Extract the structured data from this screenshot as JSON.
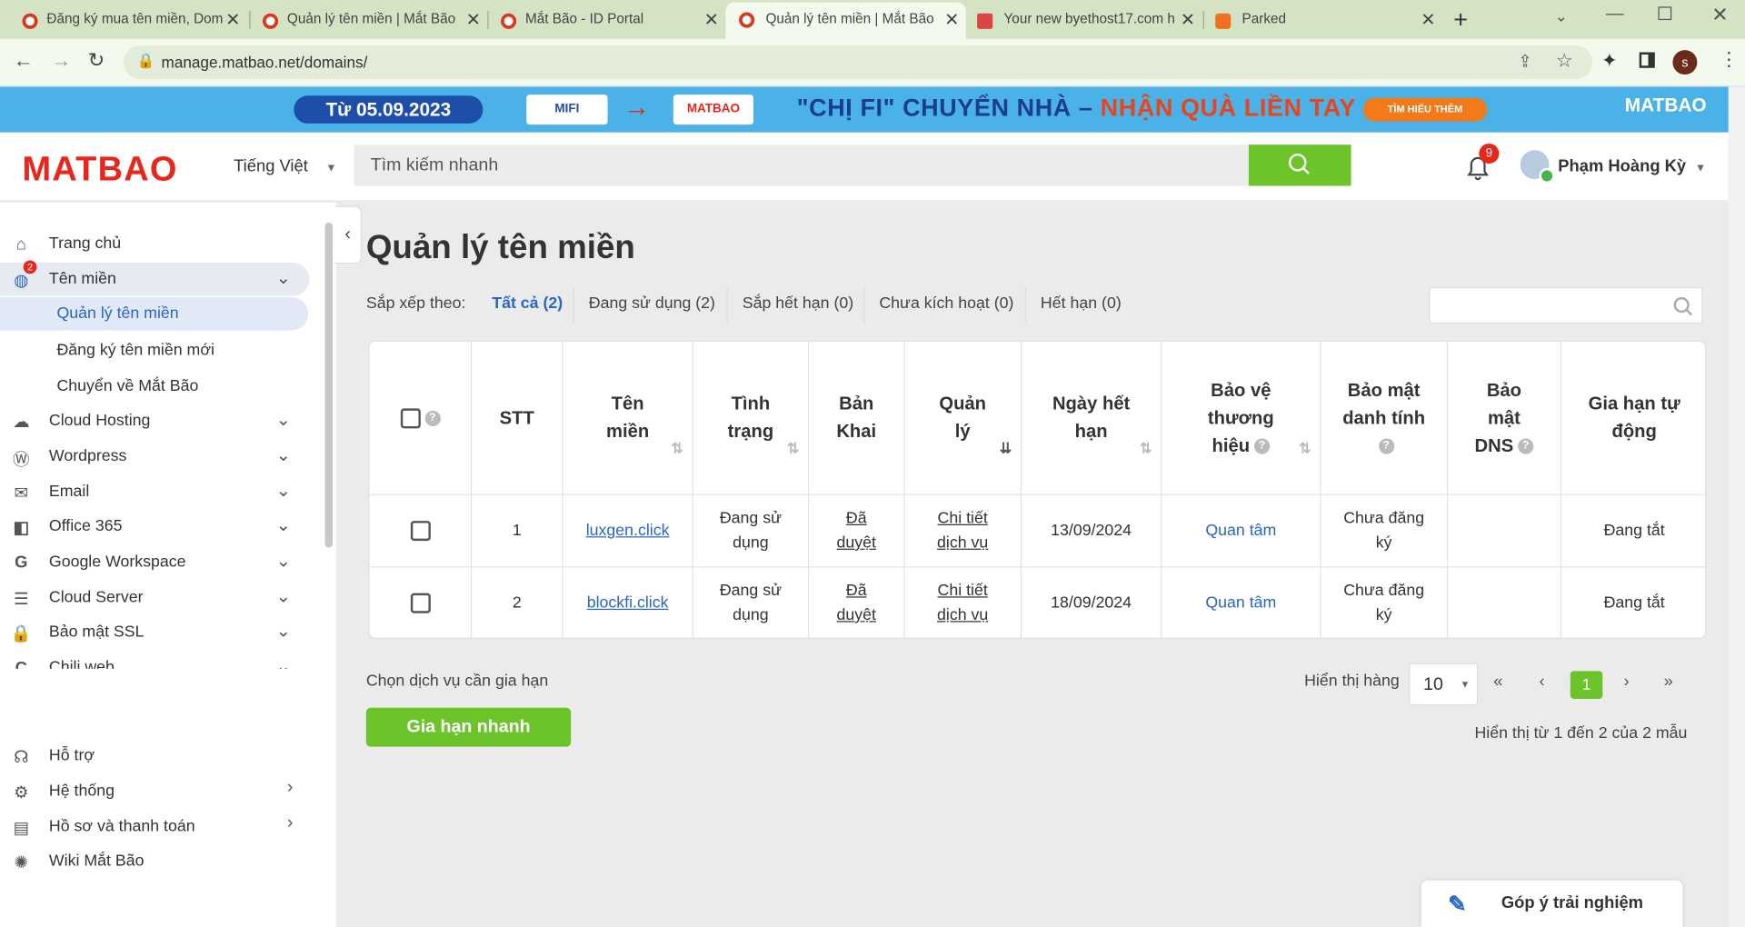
{
  "browser": {
    "tabs": [
      {
        "title": "Đăng ký mua tên miền, Dom"
      },
      {
        "title": "Quản lý tên miền | Mắt Bão"
      },
      {
        "title": "Mắt Bão - ID Portal"
      },
      {
        "title": "Quản lý tên miền | Mắt Bão"
      },
      {
        "title": "Your new byethost17.com h"
      },
      {
        "title": "Parked"
      }
    ],
    "url": "manage.matbao.net/domains/",
    "profile_initial": "s"
  },
  "banner": {
    "date": "Từ 05.09.2023",
    "mifi": "MIFI",
    "matbao_invoice": "MATBAO",
    "slogan_part1": "\"CHỊ FI\" CHUYỂN NHÀ – ",
    "slogan_part2": "NHẬN QUÀ LIỀN TAY",
    "more": "TÌM HIỂU THÊM",
    "logo": "MATBAO"
  },
  "header": {
    "logo": "MATBAO",
    "language": "Tiếng Việt",
    "search_placeholder": "Tìm kiếm nhanh",
    "notification_count": "9",
    "user_name": "Phạm Hoàng Kỳ"
  },
  "sidebar": {
    "items": [
      {
        "label": "Trang chủ"
      },
      {
        "label": "Tên miền",
        "badge": "2"
      },
      {
        "label": "Cloud Hosting"
      },
      {
        "label": "Wordpress"
      },
      {
        "label": "Email"
      },
      {
        "label": "Office 365"
      },
      {
        "label": "Google Workspace"
      },
      {
        "label": "Cloud Server"
      },
      {
        "label": "Bảo mật SSL"
      },
      {
        "label": "Chili web"
      }
    ],
    "subitems": [
      {
        "label": "Quản lý tên miền"
      },
      {
        "label": "Đăng ký tên miền mới"
      },
      {
        "label": "Chuyển về Mắt Bão"
      }
    ],
    "bottom": [
      {
        "label": "Hỗ trợ"
      },
      {
        "label": "Hệ thống"
      },
      {
        "label": "Hồ sơ và thanh toán"
      },
      {
        "label": "Wiki Mắt Bão"
      }
    ]
  },
  "main": {
    "title": "Quản lý tên miền",
    "sort_label": "Sắp xếp theo:",
    "filters": [
      "Tất cả (2)",
      "Đang sử dụng (2)",
      "Sắp hết hạn (0)",
      "Chưa kích hoạt (0)",
      "Hết hạn (0)"
    ],
    "columns": [
      "STT",
      "Tên miền",
      "Tình trạng",
      "Bản Khai",
      "Quản lý",
      "Ngày hết hạn",
      "Bảo vệ thương hiệu",
      "Bảo mật danh tính",
      "Bảo mật DNS",
      "Gia hạn tự động"
    ],
    "rows": [
      {
        "stt": "1",
        "domain": "luxgen.click",
        "status": "Đang sử dụng",
        "declaration": "Đã duyệt",
        "manage": "Chi tiết dịch vụ",
        "expiry": "13/09/2024",
        "brand": "Quan tâm",
        "privacy": "Chưa đăng ký",
        "dns": "",
        "auto_renew": "Đang tắt"
      },
      {
        "stt": "2",
        "domain": "blockfi.click",
        "status": "Đang sử dụng",
        "declaration": "Đã duyệt",
        "manage": "Chi tiết dịch vụ",
        "expiry": "18/09/2024",
        "brand": "Quan tâm",
        "privacy": "Chưa đăng ký",
        "dns": "",
        "auto_renew": "Đang tắt"
      }
    ],
    "choose_service": "Chọn dịch vụ cần gia hạn",
    "renew_button": "Gia hạn nhanh",
    "rows_label": "Hiển thị hàng",
    "rows_per_page": "10",
    "current_page": "1",
    "showing": "Hiển thị từ 1 đến 2 của 2 mẫu",
    "feedback": "Góp ý trải nghiệm"
  }
}
